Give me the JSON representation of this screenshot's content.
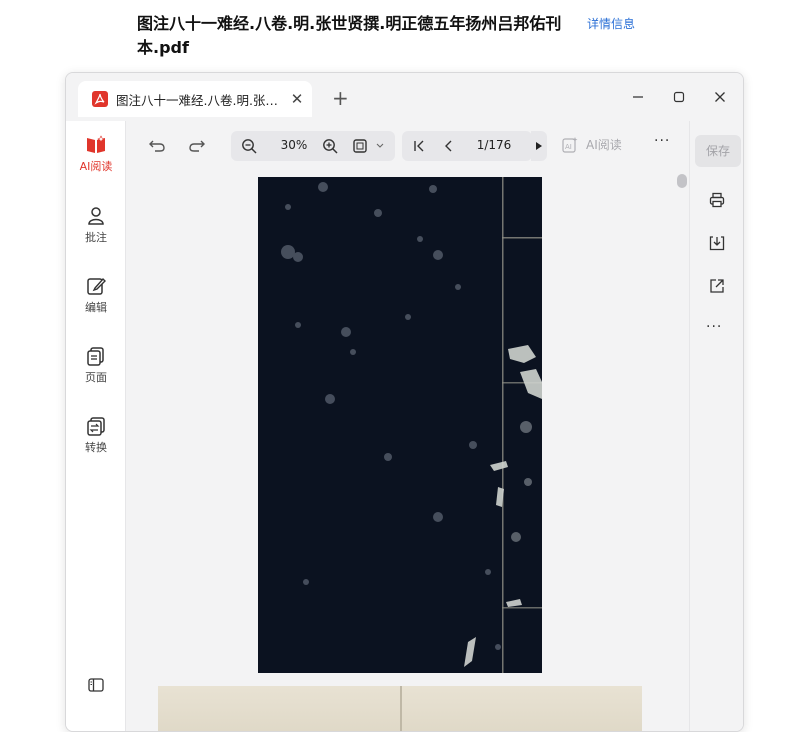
{
  "document": {
    "title": "图注八十一难经.八卷.明.张世贤撰.明正德五年扬州吕邦佑刊本.pdf",
    "details_link": "详情信息"
  },
  "window": {
    "tab": {
      "title": "图注八十一难经.八卷.明.张世..."
    },
    "icons": {
      "pdf": "pdf-icon",
      "close_tab": "close-icon",
      "new_tab": "plus-icon",
      "minimize": "minimize-icon",
      "maximize": "maximize-icon",
      "close_window": "close-icon"
    }
  },
  "left_sidebar": {
    "items": [
      {
        "label": "AI阅读",
        "icon": "ai-book-icon",
        "active": true
      },
      {
        "label": "批注",
        "icon": "annotate-icon"
      },
      {
        "label": "编辑",
        "icon": "edit-icon"
      },
      {
        "label": "页面",
        "icon": "pages-icon"
      },
      {
        "label": "转换",
        "icon": "convert-icon"
      }
    ],
    "bottom_icon": "panel-toggle-icon"
  },
  "toolbar": {
    "zoom_value": "30%",
    "page_value": "1/176",
    "ai_read_label": "AI阅读",
    "more": "···"
  },
  "right_sidebar": {
    "save_label": "保存",
    "more": "···",
    "icons": [
      "print-icon",
      "download-icon",
      "share-icon"
    ]
  },
  "colors": {
    "accent_red": "#e0352b",
    "link_blue": "#2a6fd6",
    "page_dark": "#0b1220"
  }
}
